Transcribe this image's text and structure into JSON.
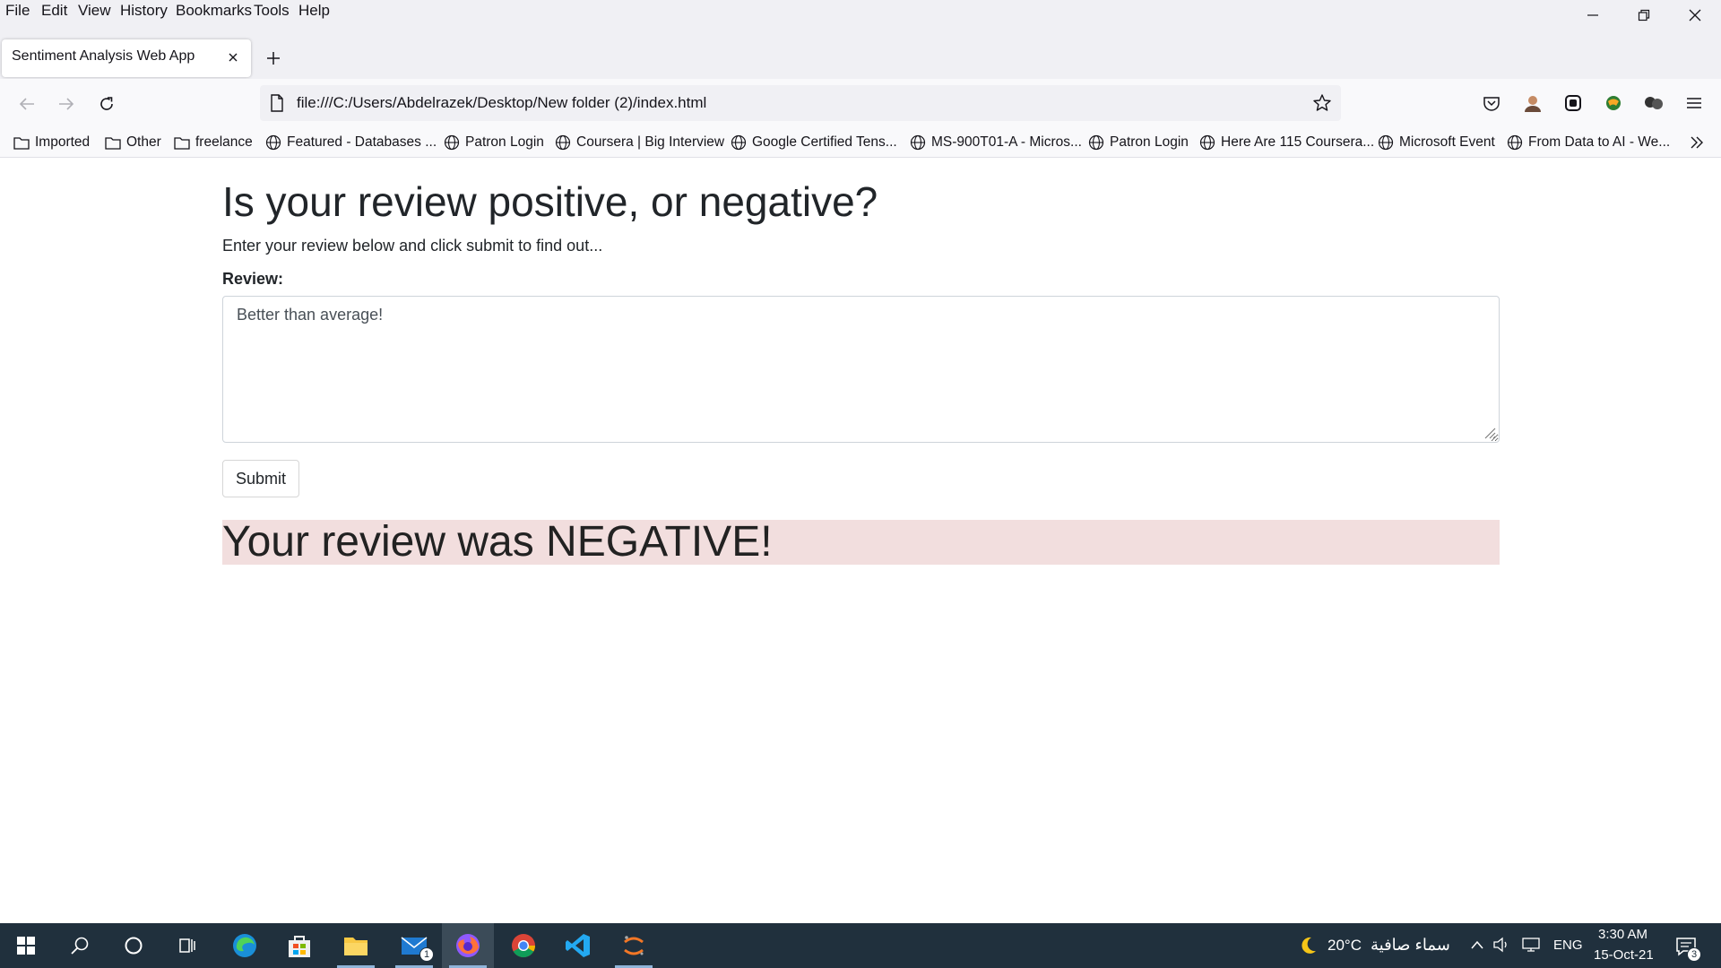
{
  "menu": {
    "items": [
      {
        "label": "File"
      },
      {
        "label": "Edit"
      },
      {
        "label": "View"
      },
      {
        "label": "History"
      },
      {
        "label": "Bookmarks"
      },
      {
        "label": "Tools"
      },
      {
        "label": "Help"
      }
    ]
  },
  "tab": {
    "title": "Sentiment Analysis Web App"
  },
  "url": "file:///C:/Users/Abdelrazek/Desktop/New folder (2)/index.html",
  "bookmarks": [
    {
      "label": "Imported",
      "icon": "folder-icon"
    },
    {
      "label": "Other",
      "icon": "folder-icon"
    },
    {
      "label": "freelance",
      "icon": "folder-icon"
    },
    {
      "label": "Featured - Databases ...",
      "icon": "globe-icon"
    },
    {
      "label": "Patron Login",
      "icon": "globe-icon"
    },
    {
      "label": "Coursera | Big Interview",
      "icon": "globe-icon"
    },
    {
      "label": "Google Certified Tens...",
      "icon": "globe-icon"
    },
    {
      "label": "MS-900T01-A - Micros...",
      "icon": "globe-icon"
    },
    {
      "label": "Patron Login",
      "icon": "globe-icon"
    },
    {
      "label": "Here Are 115 Coursera...",
      "icon": "globe-icon"
    },
    {
      "label": "Microsoft Event",
      "icon": "globe-icon"
    },
    {
      "label": "From Data to AI - We...",
      "icon": "globe-icon"
    }
  ],
  "page": {
    "heading": "Is your review positive, or negative?",
    "lead": "Enter your review below and click submit to find out...",
    "review_label": "Review:",
    "review_value": "Better than average!",
    "submit_label": "Submit",
    "result": "Your review was NEGATIVE!",
    "result_bg": "#f2dede"
  },
  "taskbar": {
    "temperature": "20°C",
    "weather": "سماء صافية",
    "language": "ENG",
    "time": "3:30 AM",
    "date": "15-Oct-21",
    "mail_badge": "1",
    "notification_badge": "3"
  }
}
